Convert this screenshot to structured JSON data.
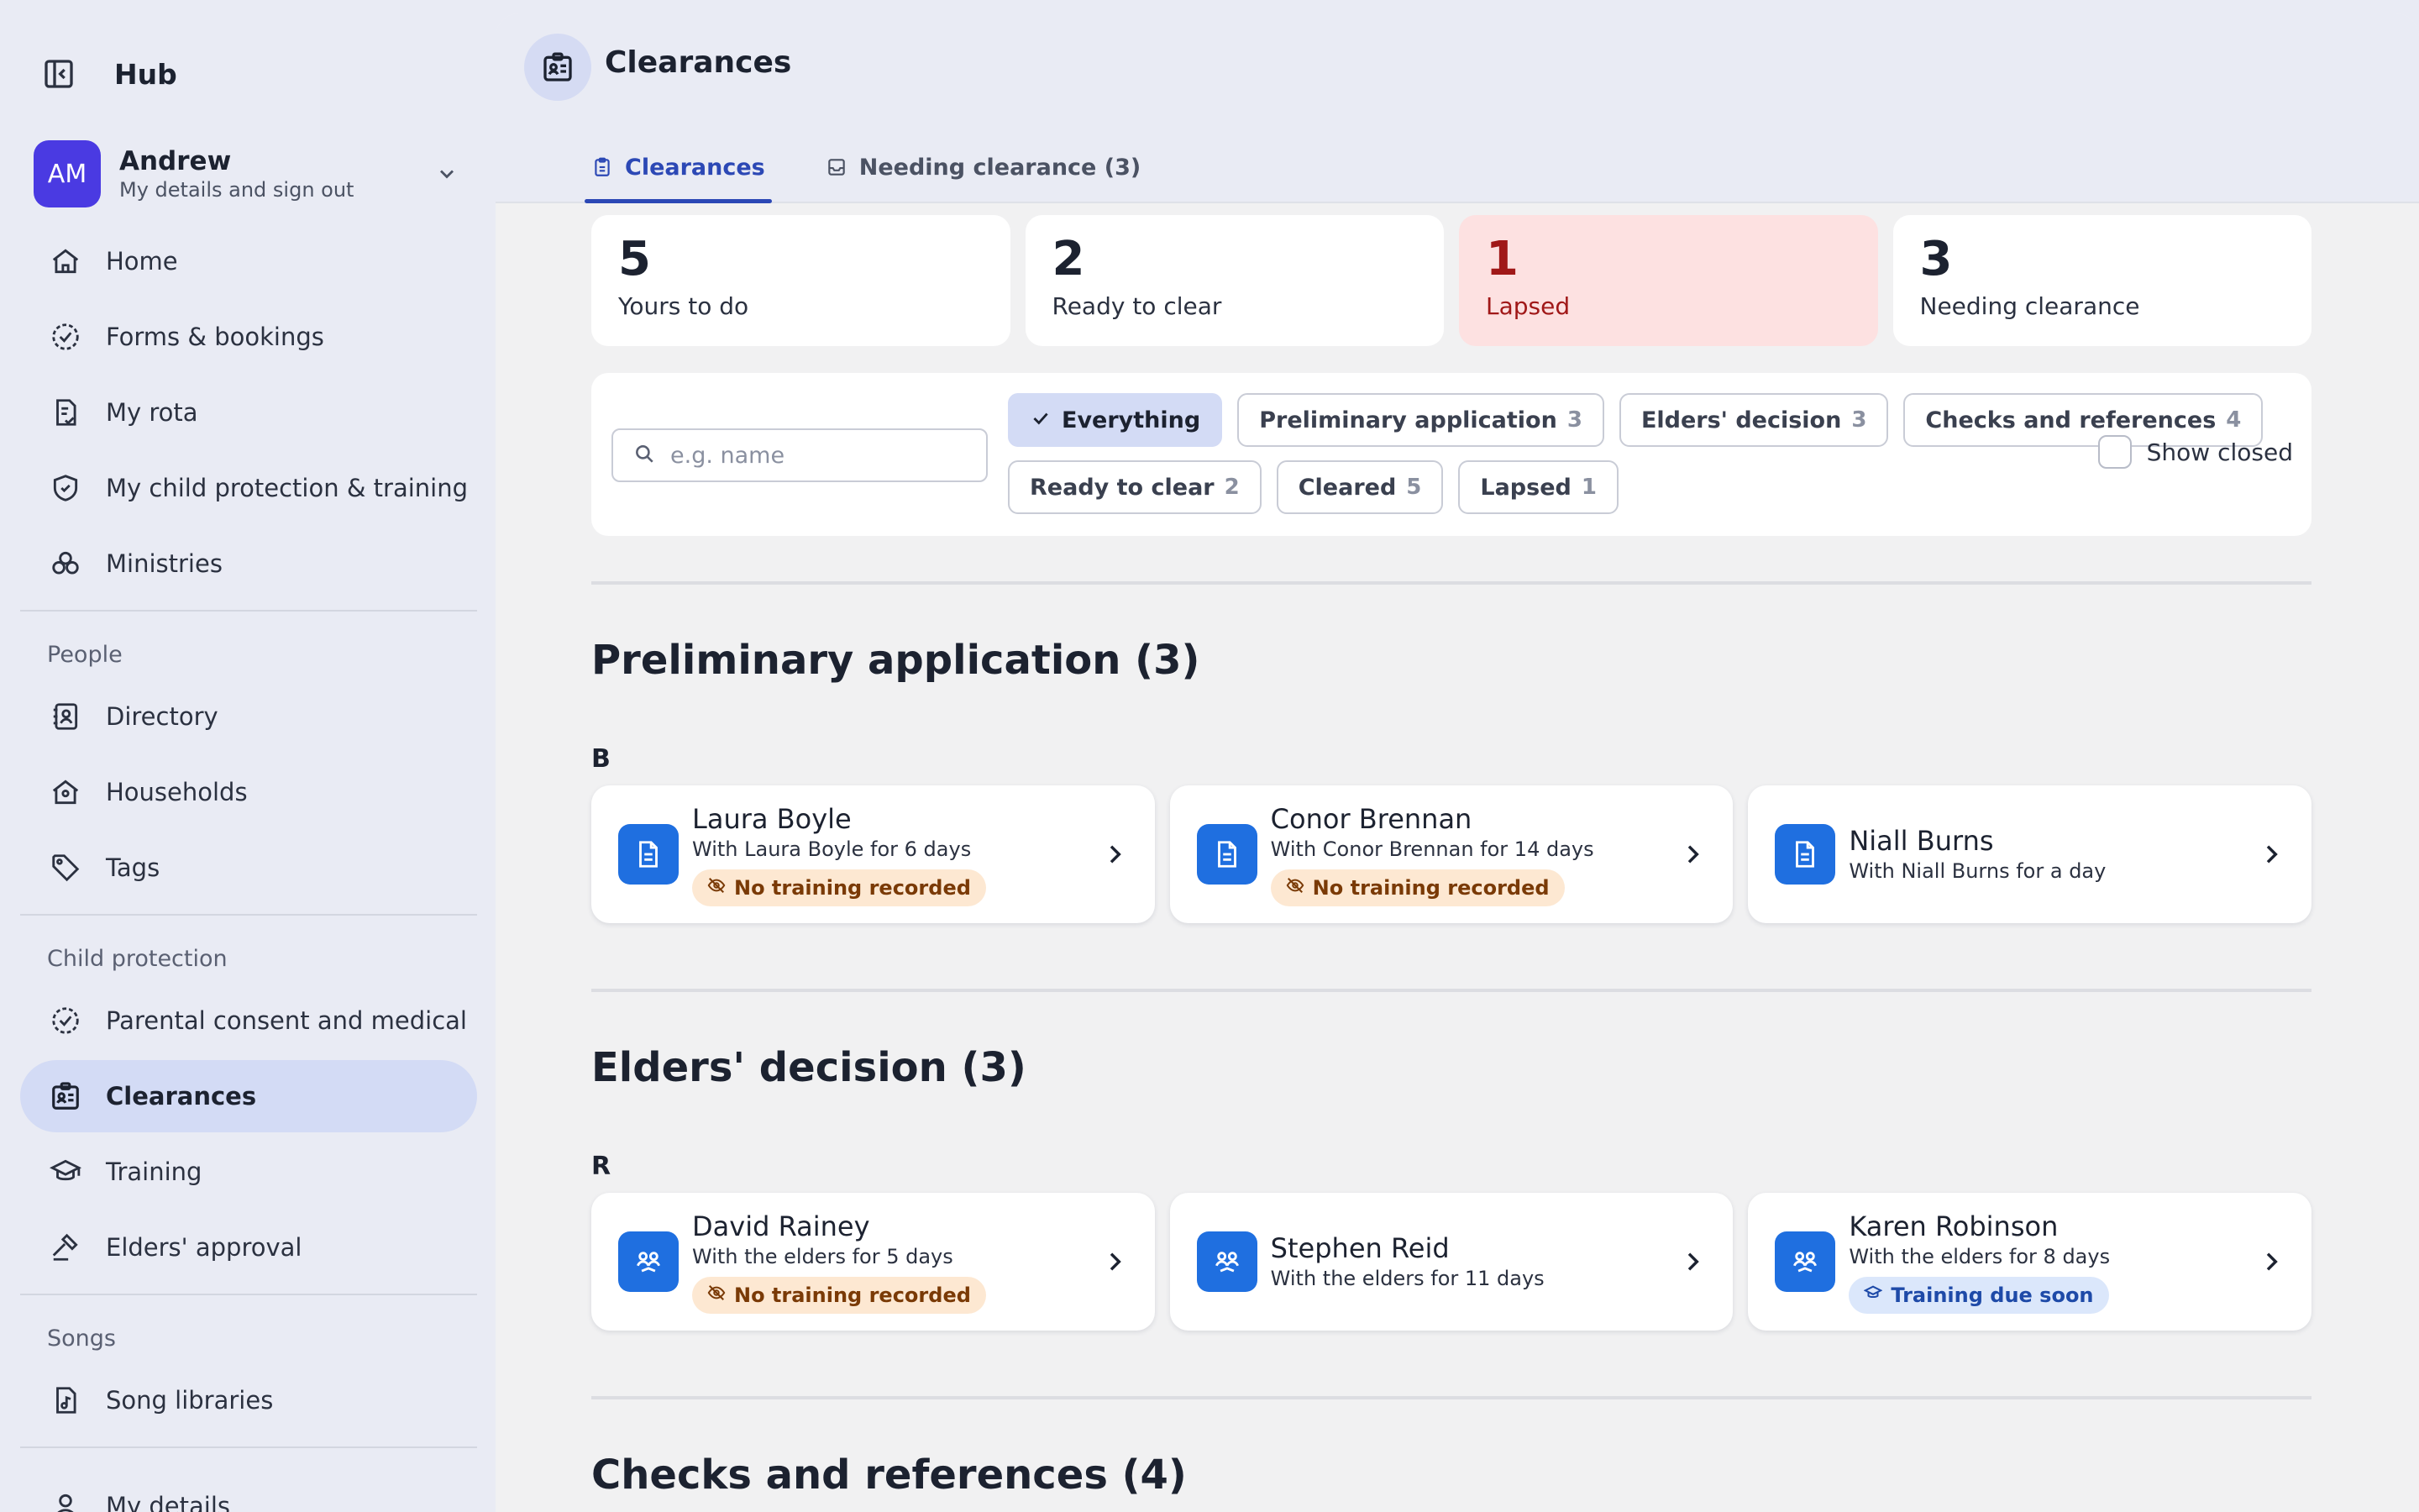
{
  "app": {
    "title": "Hub"
  },
  "user": {
    "initials": "AM",
    "name": "Andrew",
    "subtitle": "My details and sign out"
  },
  "nav": {
    "top": [
      {
        "label": "Home",
        "icon": "home-icon"
      },
      {
        "label": "Forms & bookings",
        "icon": "check-circle-icon"
      },
      {
        "label": "My rota",
        "icon": "rota-icon"
      },
      {
        "label": "My child protection & training",
        "icon": "shield-check-icon"
      },
      {
        "label": "Ministries",
        "icon": "ministries-icon"
      }
    ],
    "people_heading": "People",
    "people": [
      {
        "label": "Directory",
        "icon": "directory-icon"
      },
      {
        "label": "Households",
        "icon": "household-icon"
      },
      {
        "label": "Tags",
        "icon": "tag-icon"
      }
    ],
    "child_protection_heading": "Child protection",
    "child_protection": [
      {
        "label": "Parental consent and medical",
        "icon": "check-circle-icon"
      },
      {
        "label": "Clearances",
        "icon": "clearances-icon",
        "active": true
      },
      {
        "label": "Training",
        "icon": "graduation-cap-icon"
      },
      {
        "label": "Elders' approval",
        "icon": "gavel-icon"
      }
    ],
    "songs_heading": "Songs",
    "songs": [
      {
        "label": "Song libraries",
        "icon": "music-file-icon"
      }
    ],
    "partial": {
      "label": "My details"
    }
  },
  "page": {
    "title": "Clearances",
    "tabs": [
      {
        "label": "Clearances",
        "active": true
      },
      {
        "label": "Needing clearance (3)",
        "active": false
      }
    ]
  },
  "stats": [
    {
      "value": "5",
      "label": "Yours to do"
    },
    {
      "value": "2",
      "label": "Ready to clear"
    },
    {
      "value": "1",
      "label": "Lapsed"
    },
    {
      "value": "3",
      "label": "Needing clearance"
    }
  ],
  "filters": {
    "search_placeholder": "e.g. name",
    "search_value": "",
    "chips_row1": [
      {
        "label": "Everything",
        "count": ""
      },
      {
        "label": "Preliminary application",
        "count": "3"
      },
      {
        "label": "Elders' decision",
        "count": "3"
      },
      {
        "label": "Checks and references",
        "count": "4"
      }
    ],
    "chips_row2": [
      {
        "label": "Ready to clear",
        "count": "2"
      },
      {
        "label": "Cleared",
        "count": "5"
      },
      {
        "label": "Lapsed",
        "count": "1"
      }
    ],
    "show_closed_label": "Show closed"
  },
  "sections": [
    {
      "title": "Preliminary application (3)",
      "letter": "B",
      "cards": [
        {
          "name": "Laura Boyle",
          "sub": "With Laura Boyle for 6 days",
          "badge": "No training recorded"
        },
        {
          "name": "Conor Brennan",
          "sub": "With Conor Brennan for 14 days",
          "badge": "No training recorded"
        },
        {
          "name": "Niall Burns",
          "sub": "With Niall Burns for a day"
        }
      ]
    },
    {
      "title": "Elders' decision (3)",
      "letter": "R",
      "cards": [
        {
          "name": "David Rainey",
          "sub": "With the elders for 5 days",
          "badge": "No training recorded"
        },
        {
          "name": "Stephen Reid",
          "sub": "With the elders for 11 days"
        },
        {
          "name": "Karen Robinson",
          "sub": "With the elders for 8 days",
          "badge": "Training due soon"
        }
      ]
    },
    {
      "title": "Checks and references (4)"
    }
  ],
  "colors": {
    "accent": "#2c48b5",
    "avatar": "#4a3ae2",
    "card_icon": "#1f6fe0",
    "lapsed_bg": "#fde1e1",
    "lapsed_text": "#a01818",
    "warn_badge_bg": "#fde8d2",
    "info_badge_bg": "#dbe7fb"
  }
}
